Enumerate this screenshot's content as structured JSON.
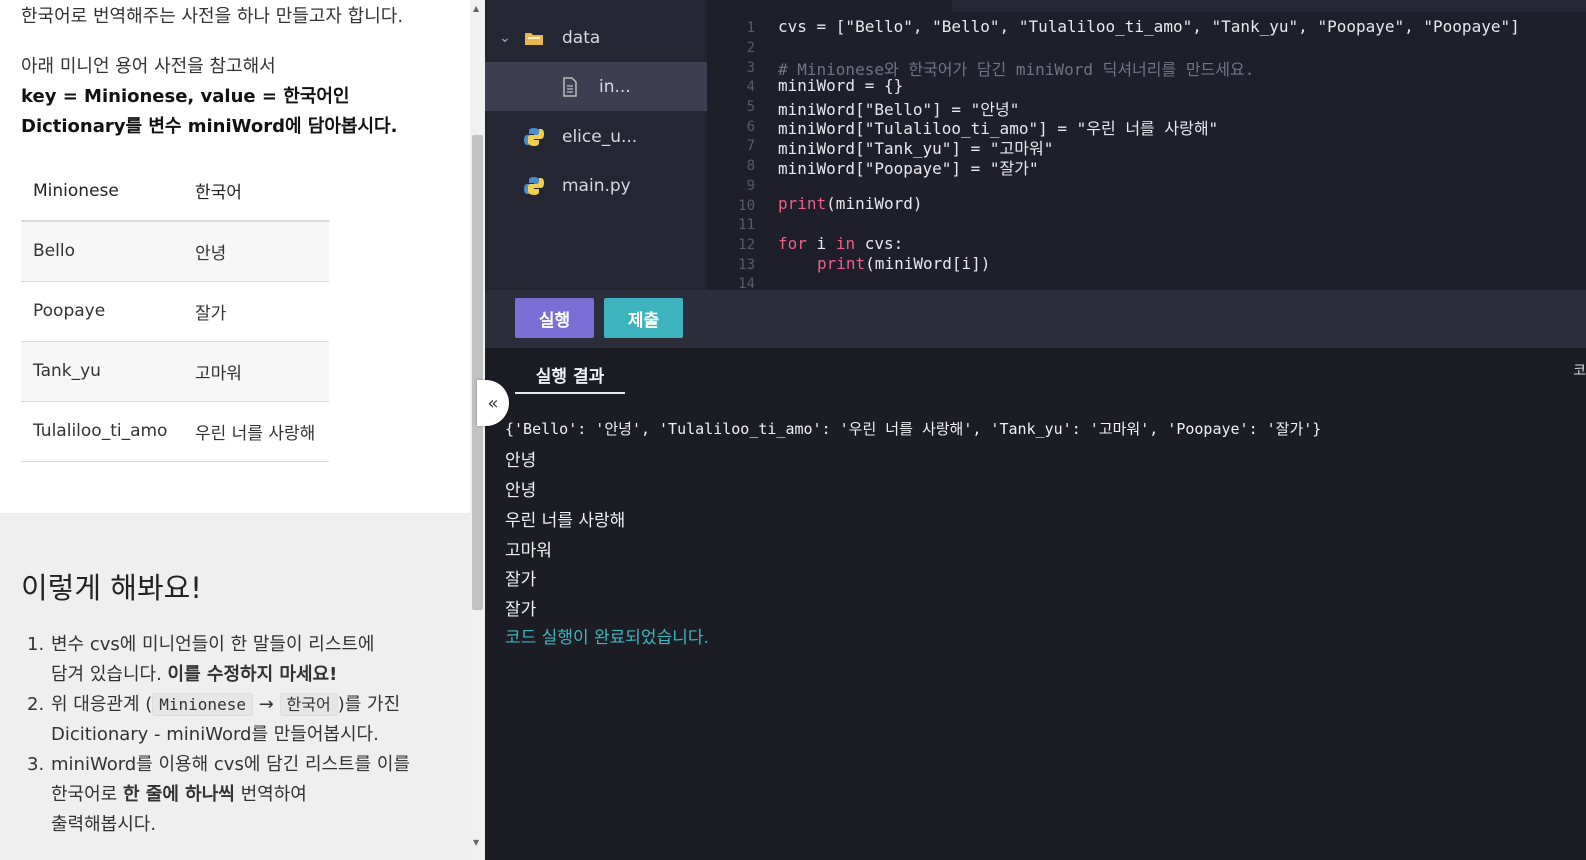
{
  "instructions": {
    "line1": "한국어로 번역해주는 사전을 하나 만들고자 합니다.",
    "line2": "아래 미니언 용어 사전을 참고해서",
    "line3": "key = Minionese, value = 한국어인",
    "line4": "Dictionary를 변수 miniWord에 담아봅시다.",
    "table": {
      "headers": [
        "Minionese",
        "한국어"
      ],
      "rows": [
        [
          "Bello",
          "안녕"
        ],
        [
          "Poopaye",
          "잘가"
        ],
        [
          "Tank_yu",
          "고마워"
        ],
        [
          "Tulaliloo_ti_amo",
          "우린 너를 사랑해"
        ]
      ]
    },
    "section_title": "이렇게 해봐요!",
    "steps": [
      {
        "num": "1.",
        "a": "변수 cvs에 미니언들이 한 말들이 리스트에",
        "b": "담겨 있습니다. ",
        "b_bold": "이를 수정하지 마세요!"
      },
      {
        "num": "2.",
        "a_pre": "위 대응관계 (",
        "chip1": "Minionese",
        "arrow": "→",
        "chip2": "한국어",
        "a_post": ")를 가진",
        "b": "Dicitionary - miniWord를 만들어봅시다."
      },
      {
        "num": "3.",
        "a": "miniWord를 이용해 cvs에 담긴 리스트를 이를",
        "b_pre": "한국어로 ",
        "b_bold": "한 줄에 하나씩",
        "b_post": " 번역하여",
        "c": "출력해봅시다."
      }
    ]
  },
  "file_tree": {
    "items": [
      {
        "label": "data",
        "type": "folder",
        "expanded": true
      },
      {
        "label": "in...",
        "type": "file",
        "selected": true
      },
      {
        "label": "elice_u...",
        "type": "python"
      },
      {
        "label": "main.py",
        "type": "python"
      }
    ]
  },
  "editor": {
    "line_numbers": [
      "1",
      "2",
      "3",
      "4",
      "5",
      "6",
      "7",
      "8",
      "9",
      "10",
      "11",
      "12",
      "13",
      "14"
    ],
    "lines": {
      "l1": "cvs = [\"Bello\", \"Bello\", \"Tulaliloo_ti_amo\", \"Tank_yu\", \"Poopaye\", \"Poopaye\"]",
      "l3": "# Minionese와 한국어가 담긴 miniWord 딕셔너리를 만드세요.",
      "l4": "miniWord = {}",
      "l5": "miniWord[\"Bello\"] = \"안녕\"",
      "l6": "miniWord[\"Tulaliloo_ti_amo\"] = \"우린 너를 사랑해\"",
      "l7": "miniWord[\"Tank_yu\"] = \"고마워\"",
      "l8": "miniWord[\"Poopaye\"] = \"잘가\"",
      "l10_fn": "print",
      "l10_rest": "(miniWord)",
      "l12_kw1": "for",
      "l12_var": " i ",
      "l12_kw2": "in",
      "l12_rest": " cvs:",
      "l13_fn": "print",
      "l13_rest": "(miniWord[i])"
    }
  },
  "toolbar": {
    "run_label": "실행",
    "submit_label": "제출"
  },
  "output": {
    "tab_label": "실행 결과",
    "edge_label": "코",
    "lines": [
      "{'Bello': '안녕', 'Tulaliloo_ti_amo': '우린 너를 사랑해', 'Tank_yu': '고마워', 'Poopaye': '잘가'}",
      "안녕",
      "안녕",
      "우린 너를 사랑해",
      "고마워",
      "잘가",
      "잘가"
    ],
    "done_message": "코드 실행이 완료되었습니다."
  },
  "colors": {
    "run_button": "#7b6fd6",
    "submit_button": "#3cb3bd",
    "keyword": "#ec5f8a",
    "done_text": "#3fb5bf"
  },
  "icons": {
    "collapse": "«",
    "chevron": "⌄"
  }
}
